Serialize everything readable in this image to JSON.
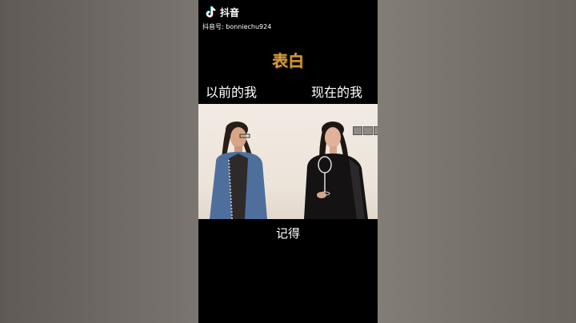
{
  "app": {
    "name": "抖音",
    "user_id": "抖音号: bonniechu924"
  },
  "video": {
    "title": "表白",
    "label_left": "以前的我",
    "label_right": "现在的我",
    "caption": "记得"
  },
  "colors": {
    "title": "#d29a3c",
    "background": "#000000",
    "text": "#ffffff"
  },
  "icons": {
    "logo": "tiktok-note-icon"
  }
}
